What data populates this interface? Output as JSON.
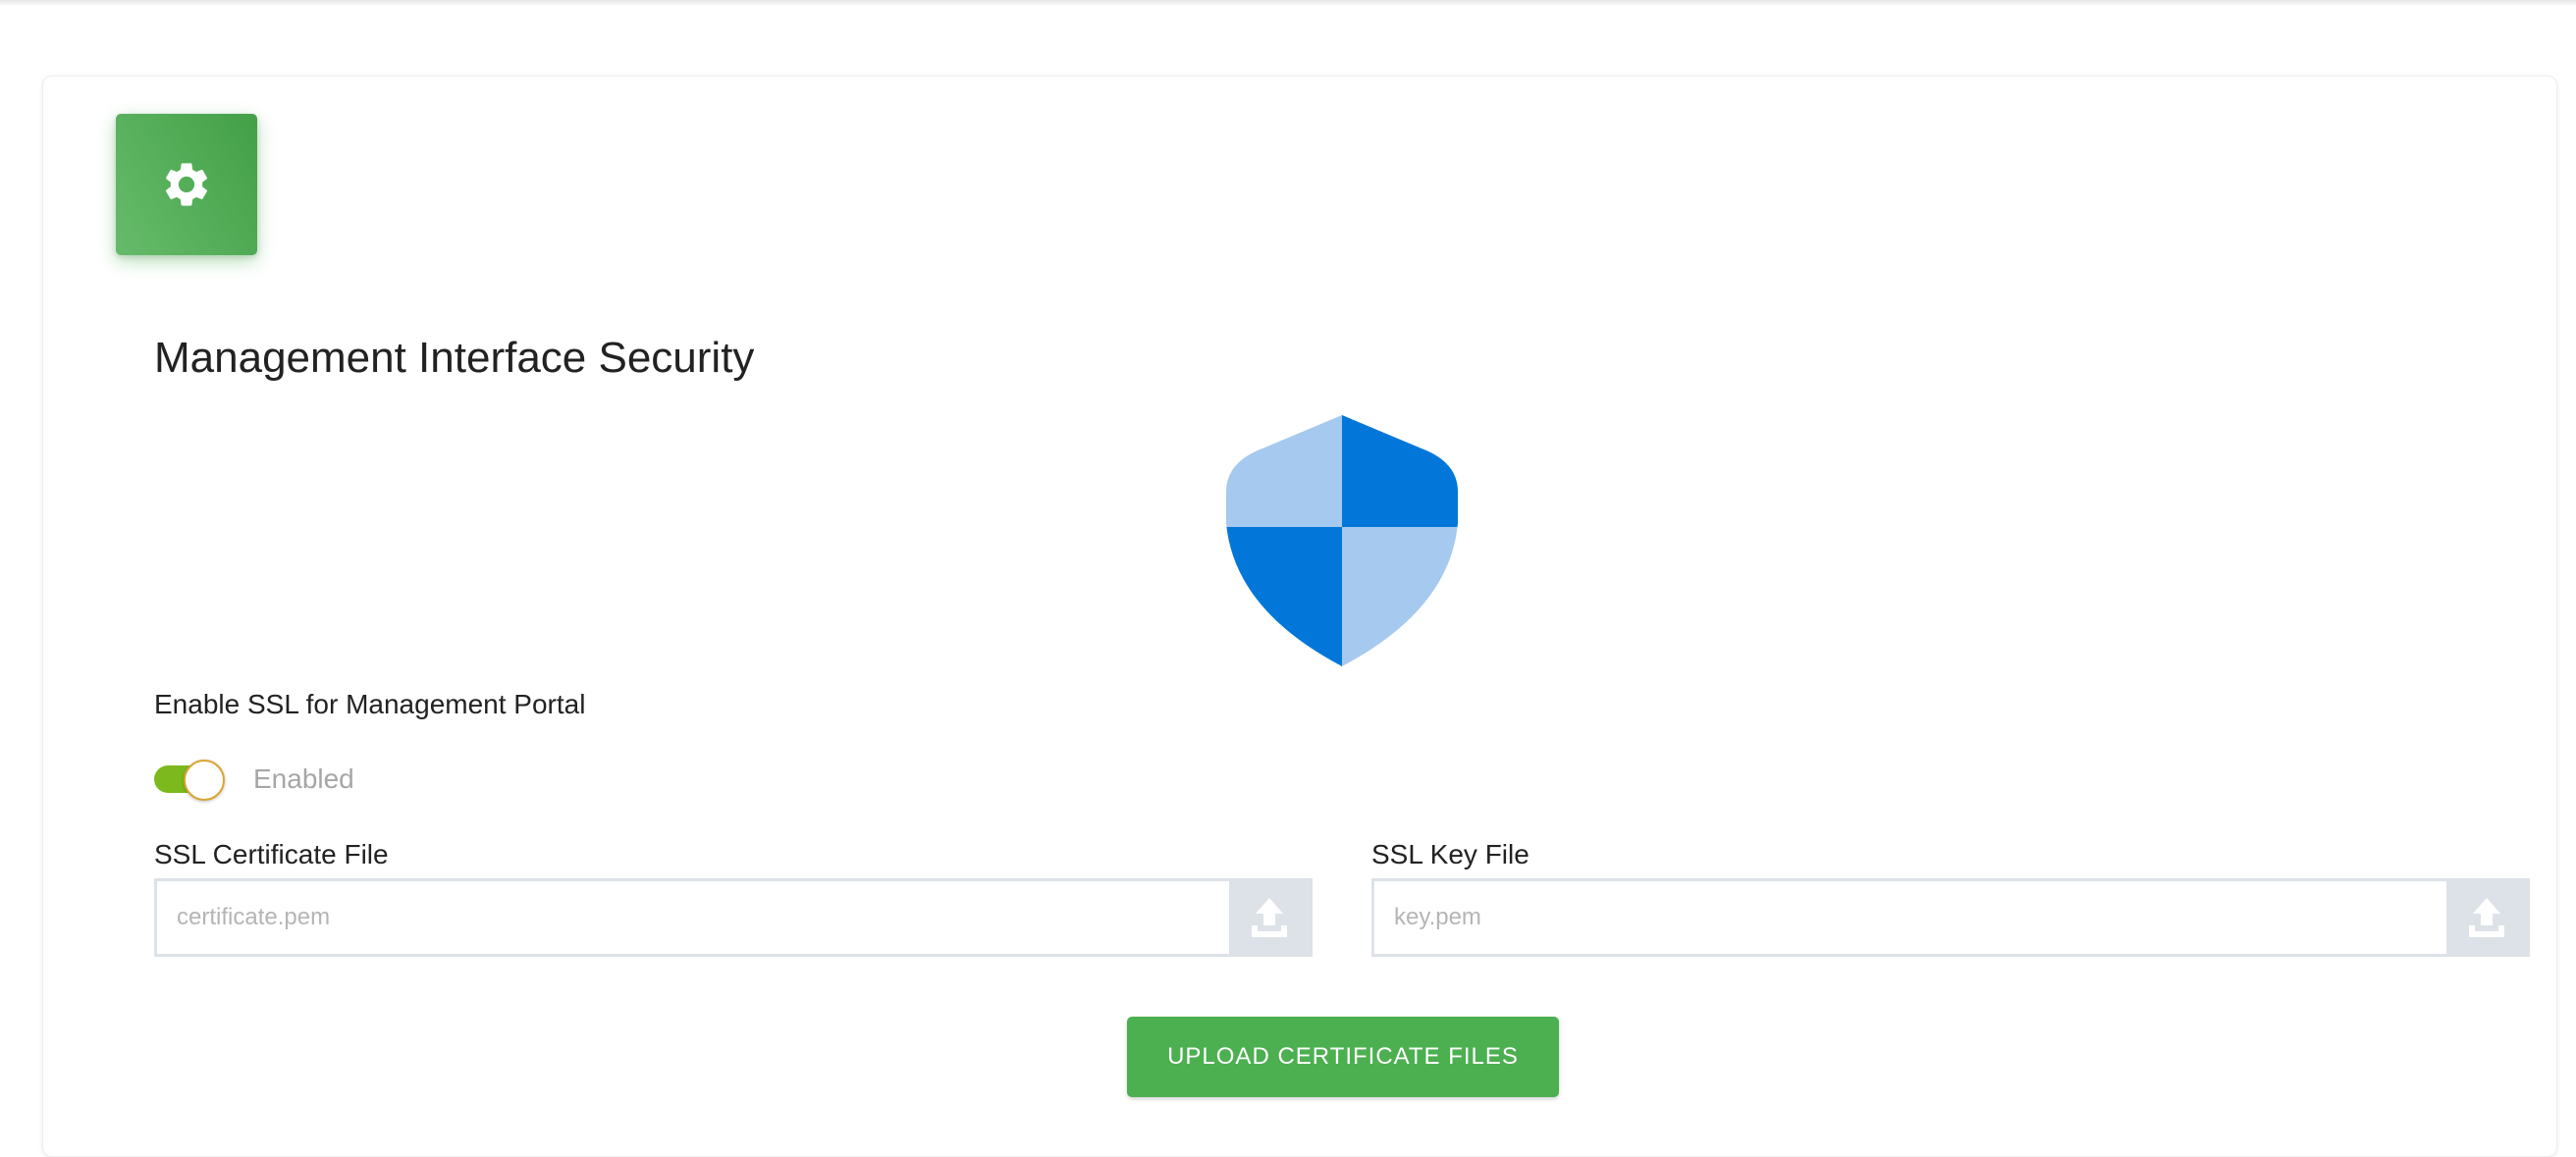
{
  "colors": {
    "accent_green": "#4caf50",
    "toggle_on": "#7cb91c",
    "shield_dark": "#0277d9",
    "shield_light": "#a6c9ef"
  },
  "header": {
    "icon": "gear-icon"
  },
  "page": {
    "title": "Management Interface Security",
    "illustration": "shield-icon"
  },
  "ssl": {
    "label": "Enable SSL for Management Portal",
    "enabled": true,
    "status_text": "Enabled"
  },
  "certificate": {
    "label": "SSL Certificate File",
    "placeholder": "certificate.pem",
    "value": "",
    "button_icon": "upload-icon"
  },
  "key": {
    "label": "SSL Key File",
    "placeholder": "key.pem",
    "value": "",
    "button_icon": "upload-icon"
  },
  "actions": {
    "upload_label": "UPLOAD CERTIFICATE FILES"
  }
}
